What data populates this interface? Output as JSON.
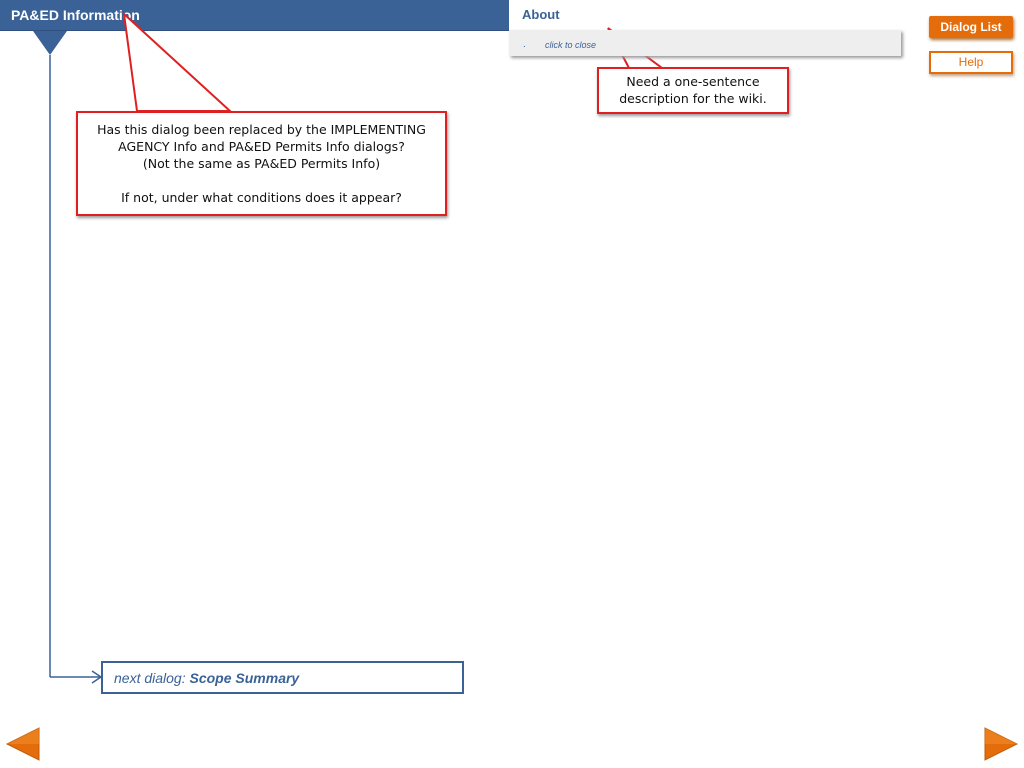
{
  "header": {
    "title": "PA&ED Information"
  },
  "about": {
    "title": "About",
    "bullet": ".",
    "close_label": "click to close"
  },
  "buttons": {
    "dialog_list": "Dialog List",
    "help": "Help"
  },
  "callouts": {
    "replacement_question": {
      "line1": "Has this dialog been replaced by the IMPLEMENTING",
      "line2": "AGENCY Info and PA&ED Permits Info dialogs?",
      "line3": "(Not the same as PA&ED Permits Info)",
      "line4": "If not, under what conditions does it appear?"
    },
    "wiki_note": {
      "line1": "Need a one-sentence",
      "line2": "description for the wiki."
    }
  },
  "next_dialog": {
    "prefix": "next dialog:",
    "name": "Scope Summary"
  },
  "nav": {
    "prev_icon": "left-arrow-icon",
    "next_icon": "right-arrow-icon",
    "accent": "#e46c0a"
  },
  "colors": {
    "header": "#3b6296",
    "accent": "#e46c0a",
    "callout_border": "#e02020"
  }
}
